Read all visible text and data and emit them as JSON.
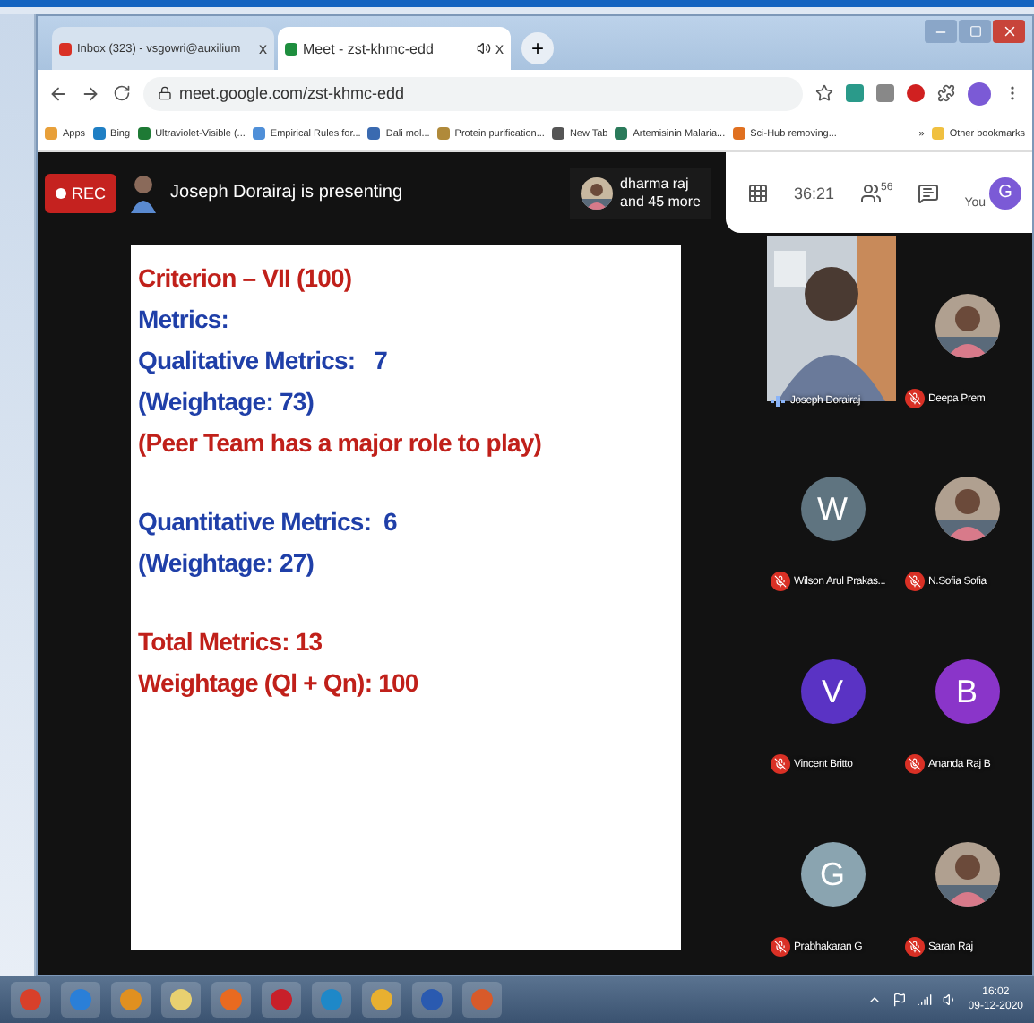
{
  "browser": {
    "tabs": [
      {
        "label": "Inbox (323) - vsgowri@auxilium",
        "close": "x",
        "selected": false,
        "audio": false
      },
      {
        "label": "Meet - zst-khmc-edd",
        "close": "x",
        "selected": true,
        "audio": true
      }
    ],
    "new_tab": "+",
    "url": "meet.google.com/zst-khmc-edd",
    "bookmarks": [
      {
        "label": "Apps",
        "color": "#e8a03a"
      },
      {
        "label": "Bing",
        "color": "#1f7fc4"
      },
      {
        "label": "Ultraviolet-Visible (...",
        "color": "#1e7a35"
      },
      {
        "label": "Empirical Rules for...",
        "color": "#4f8fd8"
      },
      {
        "label": "Dali mol...",
        "color": "#3a6ab0"
      },
      {
        "label": "Protein purification...",
        "color": "#b08a3a"
      },
      {
        "label": "New Tab",
        "color": "#555555"
      },
      {
        "label": "Artemisinin Malaria...",
        "color": "#2a7a5a"
      },
      {
        "label": "Sci-Hub removing...",
        "color": "#e07020"
      }
    ],
    "more": "»",
    "other_bookmarks": "Other bookmarks"
  },
  "meet": {
    "rec": "REC",
    "presenting": "Joseph Dorairaj is presenting",
    "others": [
      "dharma raj",
      "and 45 more"
    ],
    "timer": "36:21",
    "people_count": "56",
    "you": "You",
    "you_letter": "G",
    "slide": {
      "groups": [
        [
          {
            "kind": "heading",
            "text": "Criterion – VII (100)"
          },
          {
            "kind": "text",
            "text": "Metrics:"
          },
          {
            "kind": "text",
            "text": "Qualitative Metrics:   7"
          },
          {
            "kind": "text",
            "text": "(Weightage: 73)"
          },
          {
            "kind": "emphasis",
            "text": "(Peer Team has a major role to play)"
          }
        ],
        [
          {
            "kind": "text",
            "text": "Quantitative Metrics:  6"
          },
          {
            "kind": "text",
            "text": "(Weightage: 27)"
          }
        ],
        [
          {
            "kind": "emphasis",
            "text": "Total Metrics: 13"
          },
          {
            "kind": "emphasis",
            "text": "Weightage (Ql + Qn): 100"
          }
        ]
      ]
    },
    "participants": [
      {
        "kind": "video",
        "name": "Joseph Dorairaj",
        "muted": false
      },
      {
        "name": "Deepa Prem",
        "muted": true
      },
      {
        "kind": "letter",
        "letter": "W",
        "color": "#5f7480",
        "name": "Wilson Arul Prakas...",
        "muted": true
      },
      {
        "name": "N.Sofia Sofia",
        "muted": true
      },
      {
        "kind": "letter",
        "letter": "V",
        "color": "#5a33c4",
        "name": "Vincent Britto",
        "muted": true
      },
      {
        "kind": "letter",
        "letter": "B",
        "color": "#8a35c9",
        "name": "Ananda Raj B",
        "muted": true
      },
      {
        "kind": "letter",
        "letter": "G",
        "color": "#8aa4b0",
        "name": "Prabhakaran G",
        "muted": true
      },
      {
        "name": "Saran Raj",
        "muted": true
      }
    ]
  },
  "taskbar": {
    "apps": [
      {
        "color": "#d8402a"
      },
      {
        "color": "#2a7fd8"
      },
      {
        "color": "#e09020"
      },
      {
        "color": "#e8d070"
      },
      {
        "color": "#e86a20"
      },
      {
        "color": "#c8202a"
      },
      {
        "color": "#1e88c8"
      },
      {
        "color": "#e8b030"
      },
      {
        "color": "#2a5ab0"
      },
      {
        "color": "#d85a2a"
      }
    ],
    "time": "16:02",
    "date": "09-12-2020"
  }
}
